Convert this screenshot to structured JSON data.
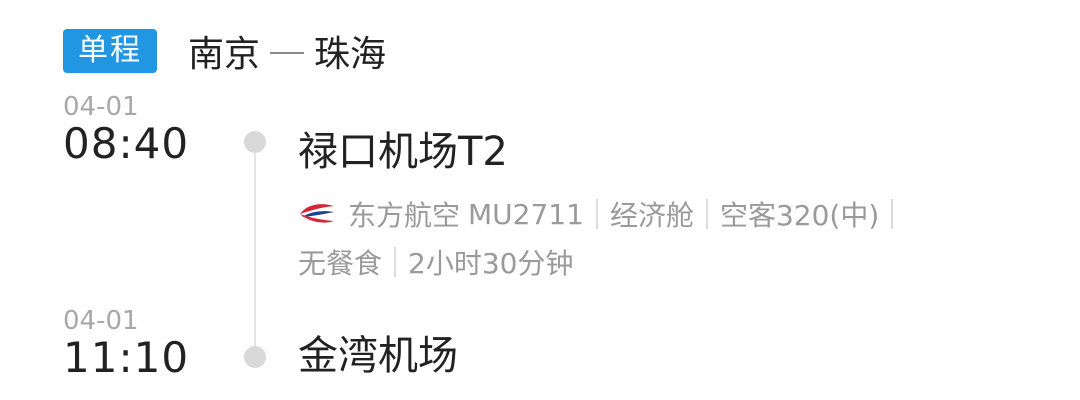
{
  "trip": {
    "type_label": "单程",
    "origin": "南京",
    "destination": "珠海"
  },
  "departure": {
    "date": "04-01",
    "time": "08:40",
    "airport": "禄口机场T2"
  },
  "flight": {
    "airline": "东方航空",
    "flight_no": "MU2711",
    "cabin": "经济舱",
    "aircraft": "空客320(中)",
    "meal": "无餐食",
    "duration": "2小时30分钟"
  },
  "arrival": {
    "date": "04-01",
    "time": "11:10",
    "airport": "金湾机场"
  },
  "colors": {
    "badge_bg": "#2196e3",
    "primary_text": "#222222",
    "secondary_text": "#9a9a9a",
    "logo_red": "#d6253a",
    "logo_blue": "#1f3f8f"
  },
  "icons": {
    "airline_logo": "china-eastern-logo-icon",
    "timeline_dot": "circle"
  }
}
